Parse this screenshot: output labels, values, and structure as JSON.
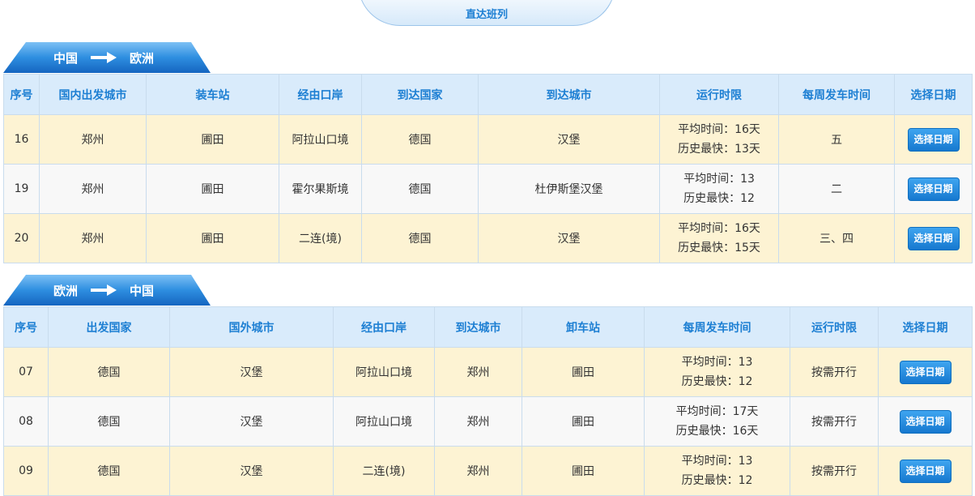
{
  "top_tab": {
    "label": "直达班列"
  },
  "outbound": {
    "from": "中国",
    "to": "欧洲",
    "headers": [
      "序号",
      "国内出发城市",
      "装车站",
      "经由口岸",
      "到达国家",
      "到达城市",
      "运行时限",
      "每周发车时间",
      "选择日期"
    ],
    "rows": [
      {
        "no": "16",
        "origin_city": "郑州",
        "loading_station": "圃田",
        "port": "阿拉山口境",
        "dest_country": "德国",
        "dest_city": "汉堡",
        "avg": "平均时间：16天",
        "best": "历史最快：13天",
        "weekly": "五",
        "btn": "选择日期"
      },
      {
        "no": "19",
        "origin_city": "郑州",
        "loading_station": "圃田",
        "port": "霍尔果斯境",
        "dest_country": "德国",
        "dest_city": "杜伊斯堡汉堡",
        "avg": "平均时间：13",
        "best": "历史最快：12",
        "weekly": "二",
        "btn": "选择日期"
      },
      {
        "no": "20",
        "origin_city": "郑州",
        "loading_station": "圃田",
        "port": "二连(境)",
        "dest_country": "德国",
        "dest_city": "汉堡",
        "avg": "平均时间：16天",
        "best": "历史最快：15天",
        "weekly": "三、四",
        "btn": "选择日期"
      }
    ]
  },
  "inbound": {
    "from": "欧洲",
    "to": "中国",
    "headers": [
      "序号",
      "出发国家",
      "国外城市",
      "经由口岸",
      "到达城市",
      "卸车站",
      "每周发车时间",
      "运行时限",
      "选择日期"
    ],
    "rows": [
      {
        "no": "07",
        "origin_country": "德国",
        "foreign_city": "汉堡",
        "port": "阿拉山口境",
        "dest_city": "郑州",
        "unloading_station": "圃田",
        "avg": "平均时间：13",
        "best": "历史最快：12",
        "limit": "按需开行",
        "btn": "选择日期"
      },
      {
        "no": "08",
        "origin_country": "德国",
        "foreign_city": "汉堡",
        "port": "阿拉山口境",
        "dest_city": "郑州",
        "unloading_station": "圃田",
        "avg": "平均时间：17天",
        "best": "历史最快：16天",
        "limit": "按需开行",
        "btn": "选择日期"
      },
      {
        "no": "09",
        "origin_country": "德国",
        "foreign_city": "汉堡",
        "port": "二连(境)",
        "dest_city": "郑州",
        "unloading_station": "圃田",
        "avg": "平均时间：13",
        "best": "历史最快：12",
        "limit": "按需开行",
        "btn": "选择日期"
      }
    ]
  },
  "colors": {
    "header_text": "#1d7fd3",
    "header_bg": "#d9ebfb",
    "row_highlight": "#fdf3d3",
    "row_plain": "#f8f8f8",
    "banner": "#1f80d6",
    "button": "#1678cf"
  }
}
